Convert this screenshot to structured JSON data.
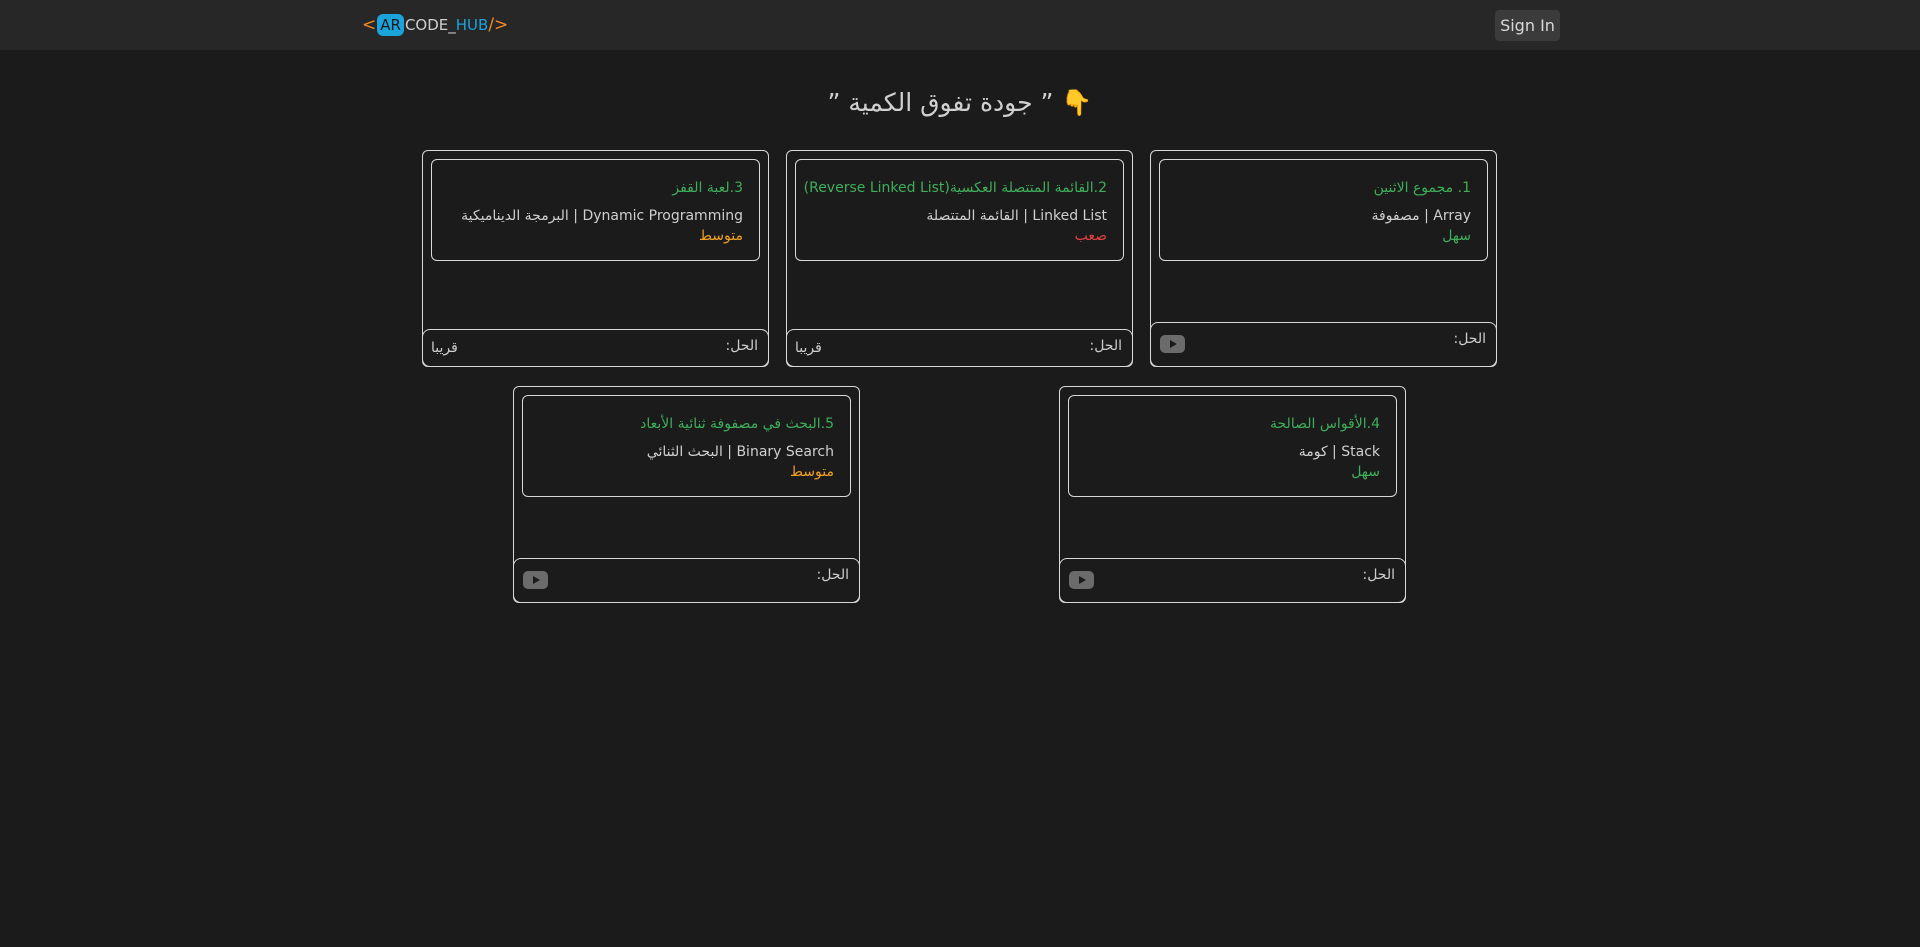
{
  "nav": {
    "logo": {
      "open": "<",
      "ar": "AR",
      "code": "CODE_",
      "hub": "HUB",
      "close": "/>"
    },
    "signin_label": "Sign In"
  },
  "headline": "👇 ” جودة تفوق الكمية ”",
  "solution_label": "الحل:",
  "soon_label": "قريبا",
  "problems": [
    {
      "title": "1. مجموع الاثنين",
      "topic": "Array | مصفوفة",
      "difficulty": "سهل",
      "difficulty_level": "easy",
      "solution": "youtube-icon"
    },
    {
      "title": "2.القائمة المتتصلة العكسية(Reverse Linked List)",
      "topic": "Linked List | القائمة المتتصلة",
      "difficulty": "صعب",
      "difficulty_level": "hard",
      "solution": "قريبا"
    },
    {
      "title": "3.لعبة القفز",
      "topic": "Dynamic Programming | البرمجة الديناميكية",
      "difficulty": "متوسط",
      "difficulty_level": "medium",
      "solution": "قريبا"
    },
    {
      "title": "4.الأقواس الصالحة",
      "topic": "Stack | كومة",
      "difficulty": "سهل",
      "difficulty_level": "easy",
      "solution": "youtube-icon"
    },
    {
      "title": "5.البحث في مصفوفة ثنائية الأبعاد",
      "topic": "Binary Search | البحث الثنائي",
      "difficulty": "متوسط",
      "difficulty_level": "medium",
      "solution": "youtube-icon"
    }
  ],
  "colors": {
    "easy": "#3fae5a",
    "medium": "#f0a020",
    "hard": "#e04040",
    "accent": "#1ba3dc",
    "brand_bracket": "#f08a24"
  }
}
